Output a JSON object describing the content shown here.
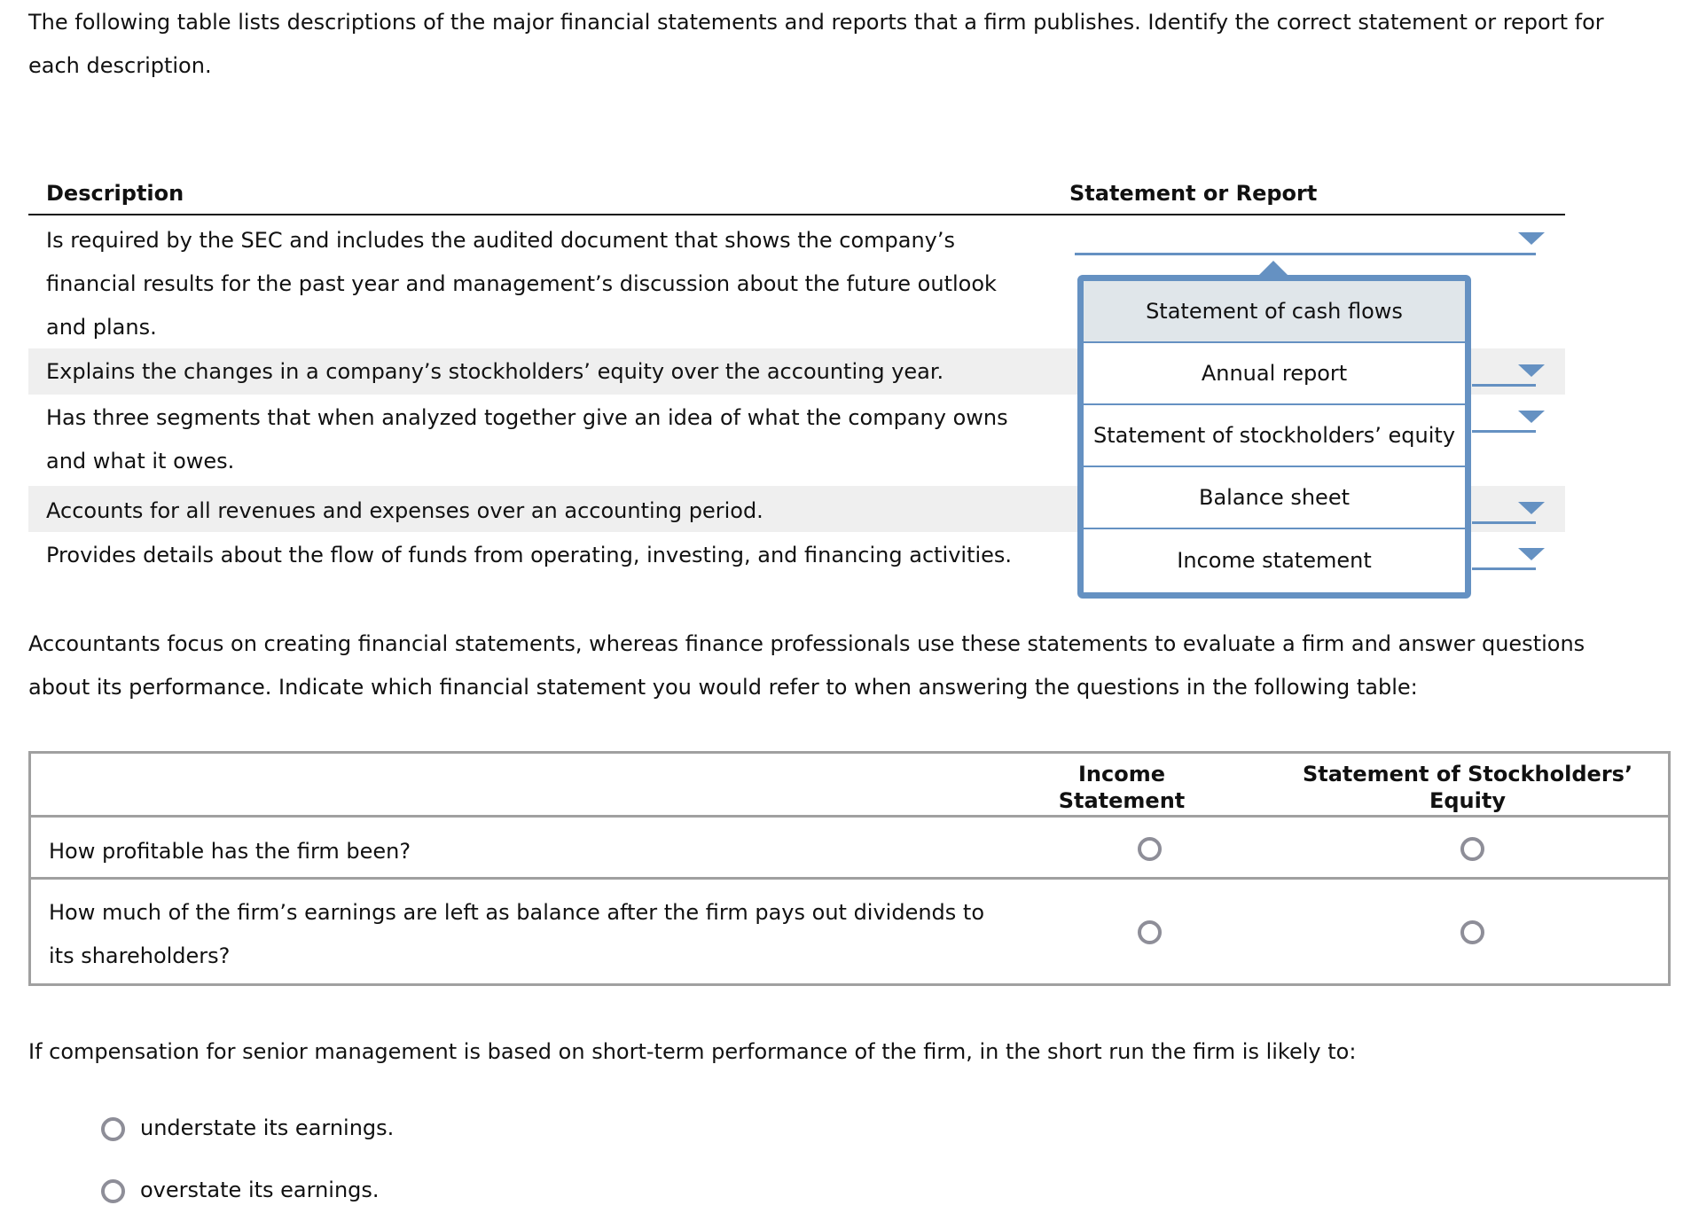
{
  "intro": {
    "line1": "The following table lists descriptions of the major financial statements and reports that a firm publishes. Identify the correct statement or report for",
    "line2": "each description."
  },
  "table1": {
    "headers": {
      "description": "Description",
      "statement": "Statement or Report"
    },
    "rows": [
      {
        "lines": [
          "Is required by the SEC and includes the audited document that shows the company’s",
          "financial results for the past year and management’s discussion about the future outlook",
          "and plans."
        ],
        "selected": ""
      },
      {
        "lines": [
          "Explains the changes in a company’s stockholders’ equity over the accounting year."
        ],
        "selected": ""
      },
      {
        "lines": [
          "Has three segments that when analyzed together give an idea of what the company owns",
          "and what it owes."
        ],
        "selected": ""
      },
      {
        "lines": [
          "Accounts for all revenues and expenses over an accounting period."
        ],
        "selected": ""
      },
      {
        "lines": [
          "Provides details about the flow of funds from operating, investing, and financing activities."
        ],
        "selected": ""
      }
    ],
    "dropdown_options": [
      "Statement of cash flows",
      "Annual report",
      "Statement of stockholders’ equity",
      "Balance sheet",
      "Income statement"
    ],
    "highlighted_option": "Statement of cash flows"
  },
  "para2": {
    "line1": "Accountants focus on creating financial statements, whereas finance professionals use these statements to evaluate a firm and answer questions",
    "line2": "about its performance. Indicate which financial statement you would refer to when answering the questions in the following table:"
  },
  "table2": {
    "col1": [
      "Income",
      "Statement"
    ],
    "col2": [
      "Statement of Stockholders’",
      "Equity"
    ],
    "rows": [
      {
        "lines": [
          "How profitable has the firm been?"
        ]
      },
      {
        "lines": [
          "How much of the firm’s earnings are left as balance after the firm pays out dividends to",
          "its shareholders?"
        ]
      }
    ]
  },
  "question3": {
    "prompt": "If compensation for senior management is based on short-term performance of the firm, in the short run the firm is likely to:",
    "options": [
      "understate its earnings.",
      "overstate its earnings."
    ]
  },
  "colors": {
    "accent": "#6591c2",
    "row_stripe": "#efefef",
    "highlight": "#e0e6ea",
    "radio": "#8e8e98"
  }
}
